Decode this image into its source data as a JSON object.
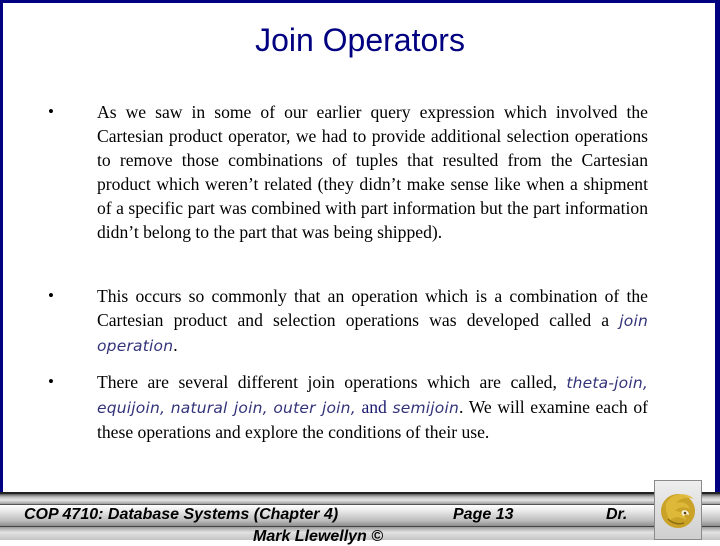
{
  "slide": {
    "title": "Join Operators",
    "bullets": [
      {
        "marker": "•",
        "text": "As we saw in some of our earlier query expression which involved the Cartesian product operator, we had to provide additional selection operations to remove those combinations of tuples that resulted from the Cartesian product which weren’t related (they didn’t make sense like when a shipment of a specific part was combined with part information but the part information didn’t belong to the part that was being shipped)."
      },
      {
        "marker": "•",
        "text_before": "This occurs so commonly that an operation which is a combination of the Cartesian product and selection operations was developed called a ",
        "term": "join operation",
        "text_after": "."
      },
      {
        "marker": "•",
        "text_before": "There are several different join operations which are called, ",
        "terms": [
          "theta-join,",
          "equijoin,",
          "natural join,",
          "outer join,"
        ],
        "conjunction": "and",
        "last_term": "semijoin",
        "text_after": ".  We will examine each of these operations and explore the conditions of their use."
      }
    ]
  },
  "footer": {
    "course": "COP 4710: Database Systems  (Chapter 4)",
    "page": "Page 13",
    "author_line1": "Dr.",
    "author_line2": "Mark Llewellyn ©",
    "logo": "ucf-pegasus-logo"
  },
  "colors": {
    "border": "#000080",
    "title": "#000080",
    "emphasis": "#33337a",
    "logo_gold": "#c9a227"
  }
}
